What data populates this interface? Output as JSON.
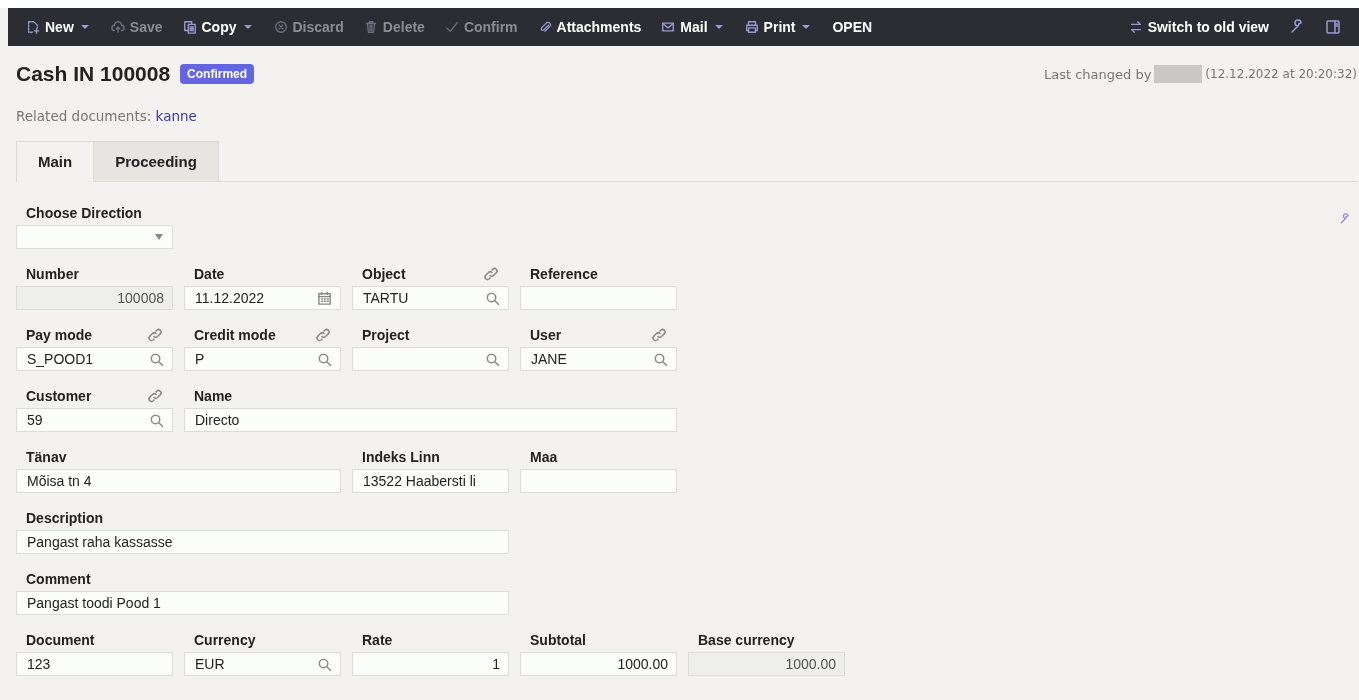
{
  "toolbar": {
    "items": [
      {
        "label": "New",
        "dropdown": true,
        "disabled": false
      },
      {
        "label": "Save",
        "dropdown": false,
        "disabled": true
      },
      {
        "label": "Copy",
        "dropdown": true,
        "disabled": false
      },
      {
        "label": "Discard",
        "dropdown": false,
        "disabled": true
      },
      {
        "label": "Delete",
        "dropdown": false,
        "disabled": true
      },
      {
        "label": "Confirm",
        "dropdown": false,
        "disabled": true
      },
      {
        "label": "Attachments",
        "dropdown": false,
        "disabled": false
      },
      {
        "label": "Mail",
        "dropdown": true,
        "disabled": false
      },
      {
        "label": "Print",
        "dropdown": true,
        "disabled": false
      },
      {
        "label": "OPEN",
        "dropdown": false,
        "disabled": false
      }
    ],
    "switch_view": "Switch to old view"
  },
  "header": {
    "title": "Cash IN 100008",
    "status": "Confirmed",
    "last_changed_label": "Last changed by",
    "last_changed_time": "(12.12.2022 at 20:20:32)",
    "related_label": "Related documents:",
    "related_link": "kanne"
  },
  "tabs": [
    {
      "label": "Main",
      "selected": true
    },
    {
      "label": "Proceeding",
      "selected": false
    }
  ],
  "form_rows": [
    [
      {
        "label": "Choose Direction",
        "kind": "select",
        "link": false
      }
    ],
    [
      {
        "label": "Number",
        "value": "100008",
        "kind": "readonly",
        "link": false
      },
      {
        "label": "Date",
        "value": "11.12.2022",
        "kind": "date",
        "link": false
      },
      {
        "label": "Object",
        "value": "TARTU",
        "kind": "lookup",
        "link": true
      },
      {
        "label": "Reference",
        "kind": "text",
        "link": false
      }
    ],
    [
      {
        "label": "Pay mode",
        "value": "S_POOD1",
        "kind": "lookup",
        "link": true
      },
      {
        "label": "Credit mode",
        "value": "P",
        "kind": "lookup",
        "link": true
      },
      {
        "label": "Project",
        "kind": "lookup",
        "link": false
      },
      {
        "label": "User",
        "value": "JANE",
        "kind": "lookup",
        "link": true
      }
    ],
    [
      {
        "label": "Customer",
        "value": "59",
        "kind": "lookup",
        "link": true
      },
      {
        "label": "Name",
        "value": "Directo",
        "kind": "text",
        "link": false
      }
    ],
    [
      {
        "label": "Tänav",
        "value": "Mõisa tn 4",
        "kind": "text",
        "link": false
      },
      {
        "label": "Indeks Linn",
        "value": "13522 Haabersti li",
        "kind": "text",
        "link": false
      },
      {
        "label": "Maa",
        "kind": "text",
        "link": false
      }
    ],
    [
      {
        "label": "Description",
        "value": "Pangast raha kassasse",
        "kind": "text",
        "link": false
      }
    ],
    [
      {
        "label": "Comment",
        "value": "Pangast toodi Pood 1",
        "kind": "text",
        "link": false
      }
    ],
    [
      {
        "label": "Document",
        "value": "123",
        "kind": "text",
        "link": false
      },
      {
        "label": "Currency",
        "value": "EUR",
        "kind": "lookup",
        "link": false
      },
      {
        "label": "Rate",
        "value": "1",
        "kind": "number",
        "link": false
      },
      {
        "label": "Subtotal",
        "value": "1000.00",
        "kind": "number",
        "link": false
      },
      {
        "label": "Base currency",
        "value": "1000.00",
        "kind": "readonly",
        "link": false
      }
    ]
  ]
}
